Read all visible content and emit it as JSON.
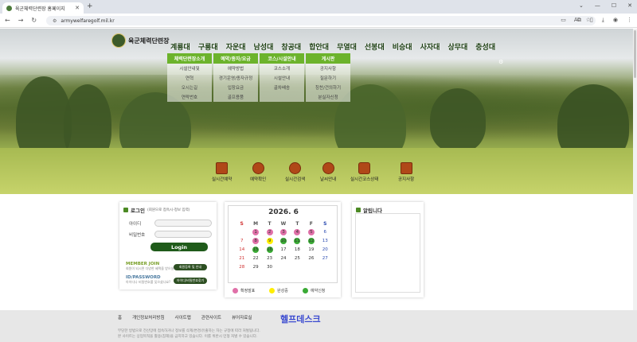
{
  "browser": {
    "tab_title": "육군체력단련장 홈페이지",
    "url": "armywelfaregolf.mil.kr"
  },
  "site": {
    "logo_text": "육군체력단련장",
    "gnb": [
      "계룡대",
      "구룡대",
      "자운대",
      "남성대",
      "창공대",
      "합안대",
      "무열대",
      "선봉대",
      "비승대",
      "사자대",
      "상무대",
      "충성대"
    ],
    "submenu": [
      {
        "title": "체력단련장소개",
        "items": [
          "시설안내및",
          "연혁",
          "오시는길",
          "연락번호"
        ]
      },
      {
        "title": "예약/종자/요금",
        "items": [
          "예약방법",
          "경기운영/종자규정",
          "입장요금",
          "골프용품"
        ]
      },
      {
        "title": "코스/시설안내",
        "items": [
          "코스소개",
          "시설안내",
          "골차배송"
        ]
      },
      {
        "title": "게시판",
        "items": [
          "공지사항",
          "질문하기",
          "칭찬/건의하기",
          "분실자신청"
        ]
      }
    ],
    "quick": [
      "실시간예약",
      "예약확인",
      "실시간검색",
      "날씨안내",
      "실시간코스상태",
      "공지사항"
    ]
  },
  "login": {
    "title": "로그인",
    "subtitle": "(회원으로 접속시-정보 입력)",
    "id_label": "아이디",
    "pw_label": "비밀번호",
    "button": "Login",
    "member_join": "MEMBER JOIN",
    "member_desc": "회원이 되시면 다양한 혜택을 받으실 수 있습니다.",
    "member_btn": "회원등록 및 안내",
    "idpw": "ID/PASSWORD",
    "idpw_desc": "아이디나 비밀번호를 잊으셨나요?",
    "idpw_btn": "아이디/비밀번호찾기"
  },
  "calendar": {
    "ym": "2026. 6",
    "weekdays": [
      "S",
      "M",
      "T",
      "W",
      "T",
      "F",
      "S"
    ],
    "days": [
      {
        "d": "",
        "s": ""
      },
      {
        "d": "1",
        "s": "pink"
      },
      {
        "d": "2",
        "s": "pink"
      },
      {
        "d": "3",
        "s": "pink"
      },
      {
        "d": "4",
        "s": "pink"
      },
      {
        "d": "5",
        "s": "pink"
      },
      {
        "d": "6",
        "s": ""
      },
      {
        "d": "7",
        "s": ""
      },
      {
        "d": "8",
        "s": "pink"
      },
      {
        "d": "9",
        "s": "yellow"
      },
      {
        "d": "10",
        "s": "green"
      },
      {
        "d": "11",
        "s": "green"
      },
      {
        "d": "12",
        "s": "green"
      },
      {
        "d": "13",
        "s": ""
      },
      {
        "d": "14",
        "s": ""
      },
      {
        "d": "15",
        "s": "green"
      },
      {
        "d": "16",
        "s": "green"
      },
      {
        "d": "17",
        "s": ""
      },
      {
        "d": "18",
        "s": ""
      },
      {
        "d": "19",
        "s": ""
      },
      {
        "d": "20",
        "s": ""
      },
      {
        "d": "21",
        "s": ""
      },
      {
        "d": "22",
        "s": ""
      },
      {
        "d": "23",
        "s": ""
      },
      {
        "d": "24",
        "s": ""
      },
      {
        "d": "25",
        "s": ""
      },
      {
        "d": "26",
        "s": ""
      },
      {
        "d": "27",
        "s": ""
      },
      {
        "d": "28",
        "s": ""
      },
      {
        "d": "29",
        "s": ""
      },
      {
        "d": "30",
        "s": ""
      },
      {
        "d": "",
        "s": ""
      },
      {
        "d": "",
        "s": ""
      },
      {
        "d": "",
        "s": ""
      },
      {
        "d": "",
        "s": ""
      }
    ],
    "legend": [
      {
        "label": "확정발표",
        "color": "#e070a8"
      },
      {
        "label": "완성중",
        "color": "#ffee00"
      },
      {
        "label": "예약신청",
        "color": "#3aaa35"
      }
    ]
  },
  "notice": {
    "title": "알립니다"
  },
  "footer": {
    "links": [
      "홈",
      "개인정보처리방침",
      "사이트맵",
      "관련사이트",
      "뷰어자료실"
    ],
    "help": "헬프데스크",
    "copy1": "부당한 방법으로 전산망에 접속하거나 정보를 삭제/변경/유출하는 자는 규정에 따라 처벌됩니다.",
    "copy2": "본 사이트는 상업목적을 활용(침해)을 금지하고 있습니다. 이를 위반시 민형 처벌 수 있습니다."
  }
}
